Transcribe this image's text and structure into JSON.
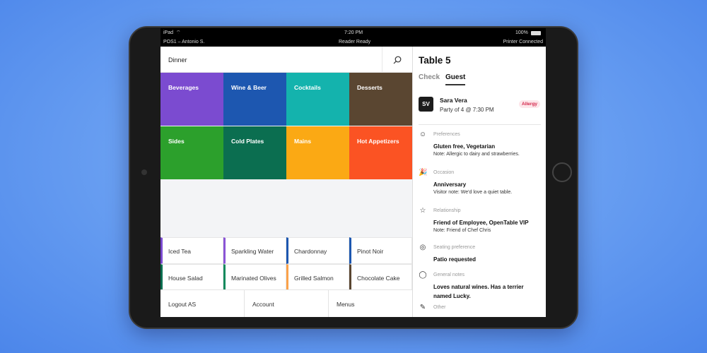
{
  "status": {
    "device": "iPad",
    "time": "7:20 PM",
    "battery": "100%",
    "terminal": "POS1 – Antonio S.",
    "reader": "Reader Ready",
    "printer": "Printer Connected"
  },
  "menu": {
    "name": "Dinner",
    "categories": [
      {
        "label": "Beverages",
        "color": "#7b4bd0"
      },
      {
        "label": "Wine & Beer",
        "color": "#1d57b0"
      },
      {
        "label": "Cocktails",
        "color": "#14b3ad"
      },
      {
        "label": "Desserts",
        "color": "#5a4631"
      },
      {
        "label": "Sides",
        "color": "#2ca02c"
      },
      {
        "label": "Cold Plates",
        "color": "#0b6e50"
      },
      {
        "label": "Mains",
        "color": "#fba914"
      },
      {
        "label": "Hot Appetizers",
        "color": "#fb5323"
      }
    ],
    "items": [
      {
        "label": "Iced Tea",
        "color": "#7b4bd0"
      },
      {
        "label": "Sparkling Water",
        "color": "#8a55d6"
      },
      {
        "label": "Chardonnay",
        "color": "#1d57b0"
      },
      {
        "label": "Pinot Noir",
        "color": "#1d57b0"
      },
      {
        "label": "House Salad",
        "color": "#0b6e50"
      },
      {
        "label": "Marinated Olives",
        "color": "#168a5e"
      },
      {
        "label": "Grilled Salmon",
        "color": "#fba24a"
      },
      {
        "label": "Chocolate Cake",
        "color": "#5a4631"
      }
    ]
  },
  "footer": [
    "Logout AS",
    "Account",
    "Menus"
  ],
  "panel": {
    "title": "Table 5",
    "tabs": [
      "Check",
      "Guest"
    ],
    "active_tab": "Guest",
    "guest": {
      "initials": "SV",
      "name": "Sara Vera",
      "party": "Party of 4 @ 7:30 PM",
      "badge": "Allergy"
    },
    "sections": [
      {
        "icon": "smiley-icon",
        "heading": "Preferences",
        "value": "Gluten free, Vegetarian",
        "note": "Note: Allergic to dairy and strawberries."
      },
      {
        "icon": "party-popper-icon",
        "heading": "Occasion",
        "value": "Anniversary",
        "note": "Visitor note: We'd love a quiet table."
      },
      {
        "icon": "star-icon",
        "heading": "Relationship",
        "value": "Friend of Employee, OpenTable VIP",
        "note": "Note: Friend of Chef Chris"
      },
      {
        "icon": "seating-icon",
        "heading": "Seating preference",
        "value": "Patio requested"
      },
      {
        "icon": "speech-bubble-icon",
        "heading": "General notes",
        "value": "Loves natural wines. Has a terrier named Lucky."
      },
      {
        "icon": "pencil-icon",
        "heading": "Other"
      }
    ]
  }
}
